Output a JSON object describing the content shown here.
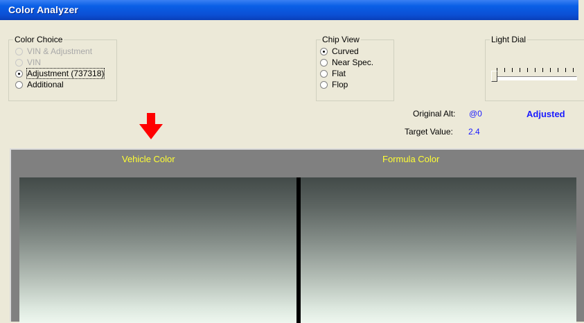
{
  "window": {
    "title": "Color Analyzer"
  },
  "color_choice": {
    "legend": "Color Choice",
    "options": [
      {
        "label": "VIN & Adjustment",
        "selected": false,
        "disabled": true
      },
      {
        "label": "VIN",
        "selected": false,
        "disabled": true
      },
      {
        "label": "Adjustment (737318)",
        "selected": true,
        "disabled": false
      },
      {
        "label": "Additional",
        "selected": false,
        "disabled": false
      }
    ]
  },
  "chip_view": {
    "legend": "Chip View",
    "options": [
      {
        "label": "Curved",
        "selected": true
      },
      {
        "label": "Near Spec.",
        "selected": false
      },
      {
        "label": "Flat",
        "selected": false
      },
      {
        "label": "Flop",
        "selected": false
      }
    ]
  },
  "light_dial": {
    "legend": "Light Dial",
    "level": 0
  },
  "info": {
    "original_alt_label": "Original Alt:",
    "original_alt_value": "@0",
    "target_value_label": "Target Value:",
    "target_value": "2.4",
    "status": "Adjusted"
  },
  "panels": {
    "vehicle_title": "Vehicle Color",
    "formula_title": "Formula Color"
  },
  "colors": {
    "title_bar": "#0B4FD4",
    "accent_blue": "#1A1AFF",
    "panel_title": "#FFFF33",
    "arrow": "#FF0000",
    "window_bg": "#ECE9D8"
  },
  "icons": {
    "pointer": "down-arrow-icon"
  }
}
